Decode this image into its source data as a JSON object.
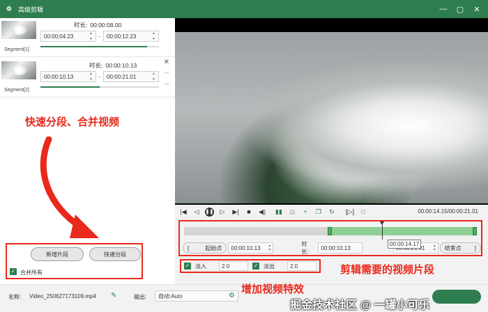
{
  "window": {
    "title": "高级剪辑",
    "controls": [
      "—",
      "▢",
      "✕"
    ]
  },
  "segments": [
    {
      "label": "Segment[1]",
      "duration_key": "时长:",
      "duration": "00:00:08.00",
      "start": "00:00:04.23",
      "end": "00:00:12.23",
      "dash": "–",
      "progress": 0.9
    },
    {
      "label": "Segment[2]",
      "duration_key": "时长:",
      "duration": "00:00:10.13",
      "start": "00:00:10.13",
      "end": "00:00:21.01",
      "dash": "–",
      "progress": 0.5
    }
  ],
  "annotations": {
    "left": "快速分段、合并视频",
    "trim": "剪辑需要的视频片段",
    "effects": "增加视频特效",
    "watermark": "掘金技术社区 @ 一罐小可乐"
  },
  "buttons": {
    "add_segment": "新增片段",
    "quick_split": "快速分段",
    "merge_all": "合并所有"
  },
  "controls": {
    "timecode": "00:00:14.15/00:00:21.01"
  },
  "trim": {
    "start_btn": "起始点",
    "start_time": "00:00:10.13",
    "duration_label": "时长:",
    "duration": "00:00:10.13",
    "end_time": "00:00:21.01",
    "end_btn": "结束点",
    "tooltip": "00:00:14.17",
    "selection_start_fraction": 0.49,
    "selection_end_fraction": 1.0,
    "playhead_fraction": 0.675
  },
  "effects": {
    "fade_in_label": "淡入",
    "fade_in_value": "2.0",
    "fade_out_label": "淡出",
    "fade_out_value": "2.0"
  },
  "footer": {
    "name_label": "名称:",
    "name_value": "Video_250627173109.mp4",
    "output_label": "输出:",
    "output_value": "自动:Auto"
  },
  "colors": {
    "accent": "#2e7d4f",
    "annotation": "#e8291c"
  }
}
